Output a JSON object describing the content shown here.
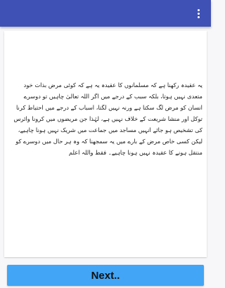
{
  "appbar": {
    "color": "#3f51b5",
    "menu_icon": "more-vertical-icon"
  },
  "content": {
    "text": "یہ عقیدہ رکھنا ہے کہ مسلمانوں کا عقیدہ یہ ہے کہ کوئی مرض بذات خود متعدی نہیں ہوتا، بلکہ سبب کے درجے میں اگر اللہ تعالیٰ چاہیں تو دوسرے انسان کو مرض لگ سکتا ہے ورنہ نہیں لگتا، اسباب کے درجے میں احتیاط کرنا توکل اور منشا شریعت کے خلاف نہیں ہے، لہٰذا جن مریضوں میں کرونا وائرس کی تشخیص ہو جائے انہیں مساجد میں جماعت میں شریک نہیں ہونا چاہیے، لیکن کسی خاص مرض کے بارے میں یہ سمجھنا کہ وہ ہر حال میں دوسرے کو منتقل ہونے کا عقیدہ نہیں ہونا چاہیے۔ فقط واللہ اعلم"
  },
  "footer": {
    "next_label": "Next..",
    "button_color": "#42a5f5"
  }
}
